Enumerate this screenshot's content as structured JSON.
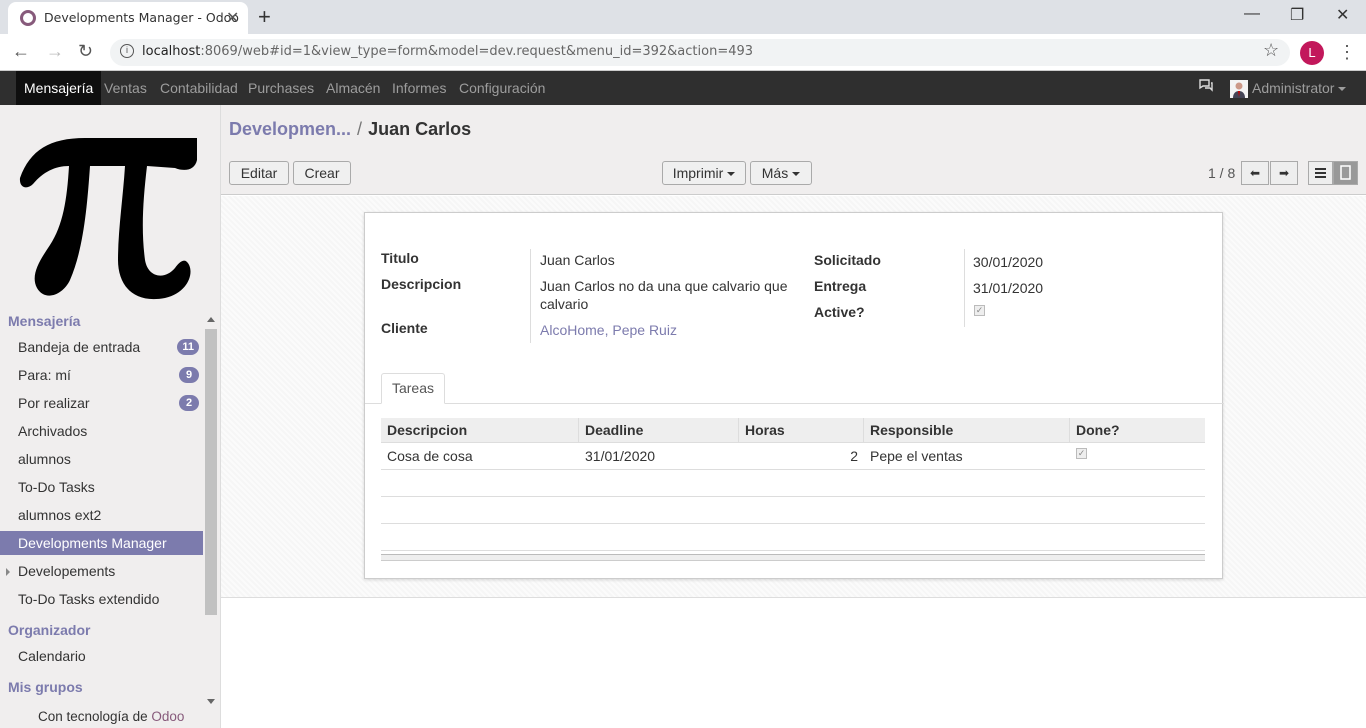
{
  "browser": {
    "tab_title": "Developments Manager - Odoo",
    "url_host": "localhost",
    "url_rest": ":8069/web#id=1&view_type=form&model=dev.request&menu_id=392&action=493",
    "profile_initial": "L"
  },
  "topbar": {
    "menus": [
      "Mensajería",
      "Ventas",
      "Contabilidad",
      "Purchases",
      "Almacén",
      "Informes",
      "Configuración"
    ],
    "user": "Administrator"
  },
  "sidebar": {
    "section1": "Mensajería",
    "items": [
      {
        "label": "Bandeja de entrada",
        "badge": "11"
      },
      {
        "label": "Para: mí",
        "badge": "9"
      },
      {
        "label": "Por realizar",
        "badge": "2"
      },
      {
        "label": "Archivados"
      },
      {
        "label": "alumnos"
      },
      {
        "label": "To-Do Tasks"
      },
      {
        "label": "alumnos ext2"
      },
      {
        "label": "Developments Manager"
      },
      {
        "label": "Developements"
      },
      {
        "label": "To-Do Tasks extendido"
      }
    ],
    "section2": "Organizador",
    "calendar": "Calendario",
    "section3": "Mis grupos",
    "footer_prefix": "Con tecnología de",
    "footer_brand": "Odoo"
  },
  "control_panel": {
    "breadcrumb_parent": "Developmen...",
    "breadcrumb_sep": "/",
    "breadcrumb_current": "Juan Carlos",
    "edit_label": "Editar",
    "create_label": "Crear",
    "print_label": "Imprimir",
    "more_label": "Más",
    "pager": "1 / 8"
  },
  "form": {
    "titulo_label": "Titulo",
    "titulo": "Juan Carlos",
    "descripcion_label": "Descripcion",
    "descripcion_line1": "Juan Carlos no da una que calvario que",
    "descripcion_line2": "calvario",
    "cliente_label": "Cliente",
    "cliente": "AlcoHome, Pepe Ruiz",
    "solicitado_label": "Solicitado",
    "solicitado": "30/01/2020",
    "entrega_label": "Entrega",
    "entrega": "31/01/2020",
    "active_label": "Active?",
    "active": true
  },
  "tasks": {
    "tab_label": "Tareas",
    "columns": [
      "Descripcion",
      "Deadline",
      "Horas",
      "Responsible",
      "Done?"
    ],
    "rows": [
      {
        "descripcion": "Cosa de cosa",
        "deadline": "31/01/2020",
        "horas": "2",
        "responsible": "Pepe el ventas",
        "done": true
      }
    ]
  }
}
